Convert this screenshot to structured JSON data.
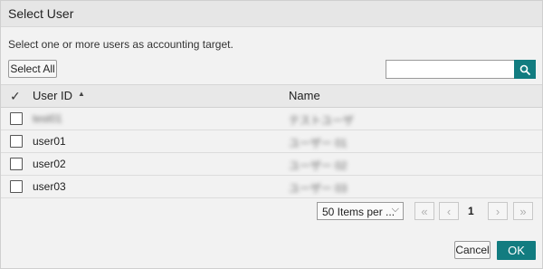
{
  "dialog": {
    "title": "Select User",
    "instruction": "Select one or more users as accounting target.",
    "select_all_label": "Select All",
    "search": {
      "value": "",
      "placeholder": ""
    },
    "icons": {
      "search": "search-icon",
      "header_check": "checkmark-icon",
      "sort": "sort-ascending-icon"
    },
    "columns": {
      "check": "✓",
      "user_id": "User ID",
      "sort_indicator": "▲",
      "name": "Name"
    },
    "rows": [
      {
        "user_id": "test01",
        "name": "テストユーザ",
        "blurred": true
      },
      {
        "user_id": "user01",
        "name": "ユーザー 01",
        "blurred_name": true
      },
      {
        "user_id": "user02",
        "name": "ユーザー 02",
        "blurred_name": true
      },
      {
        "user_id": "user03",
        "name": "ユーザー 03",
        "blurred_name": true
      }
    ],
    "pagination": {
      "page_size_label": "50 Items per ...",
      "first": "«",
      "prev": "‹",
      "current_page": "1",
      "next": "›",
      "last": "»"
    },
    "cancel_label": "Cancel",
    "ok_label": "OK",
    "colors": {
      "accent": "#127c80",
      "background": "#f2f2f2",
      "header": "#e8e8e8"
    }
  }
}
